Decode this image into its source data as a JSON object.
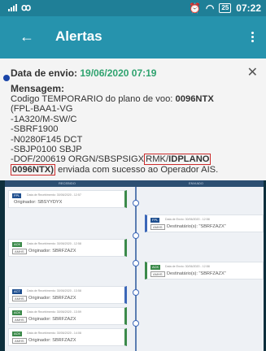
{
  "status_bar": {
    "carrier": "ꝏ",
    "time": "07:22",
    "battery": "25"
  },
  "app_bar": {
    "title": "Alertas"
  },
  "notification": {
    "date_label": "Data de envio:",
    "date_value": "19/06/2020 07:19",
    "message_label": "Mensagem:",
    "line1_prefix": "Codigo TEMPORARIO do plano de voo: ",
    "plan_code": "0096NTX",
    "lines": "(FPL-BAA1-VG\n-1A320/M-SW/C\n-SBRF1900\n-N0280F145 DCT\n-SBJP0100 SBJP",
    "last_prefix": "-DOF/200619 ORGN/SBSPSIGX",
    "hl1_plain": "RMK/",
    "hl1_bold": "IDPLANO",
    "hl2": "0096NTX)",
    "last_suffix": " enviada com sucesso ao Operador AIS."
  },
  "timeline": {
    "header_left": "RECEBIDO",
    "header_right": "ENVIADO",
    "events": [
      {
        "tag": "FPL",
        "date": "Data de Recebimento: 30/06/2020 - 12:57",
        "badge": "",
        "text": "Originador: SBSYYDYX"
      },
      {
        "tag": "FPL",
        "date": "Data de Envio: 30/06/2020 - 12:58",
        "badge": "AMHS",
        "text": "Destinatário(s): \"SBRFZAZX\""
      },
      {
        "tag": "ACK",
        "date": "Data de Recebimento: 30/06/2020 - 12:58",
        "badge": "AMHS",
        "text": "Originador: SBRFZAZX"
      },
      {
        "tag": "ACK",
        "date": "Data de Envio: 30/06/2020 - 12:58",
        "badge": "AMHS",
        "text": "Destinatário(s): \"SBRFZAZX\""
      },
      {
        "tag": "ACT",
        "date": "Data de Recebimento: 30/06/2020 - 13:58",
        "badge": "AMHS",
        "text": "Originador: SBRFZAZX"
      },
      {
        "tag": "ACK",
        "date": "Data de Recebimento: 30/06/2020 - 13:59",
        "badge": "AMHS",
        "text": "Originador: SBRFZAZX"
      },
      {
        "tag": "ACK",
        "date": "Data de Recebimento: 30/06/2020 - 14:08",
        "badge": "AMHS",
        "text": "Originador: SBRFZAZX"
      }
    ]
  },
  "colors": {
    "appbar": "#2693ad",
    "status_bar": "#1f7f97",
    "date_green": "#2fa36f",
    "highlight_box": "#cc2c2c"
  },
  "icons": {
    "back": "arrow-left-icon",
    "menu": "more-vert-icon",
    "close": "close-icon"
  }
}
